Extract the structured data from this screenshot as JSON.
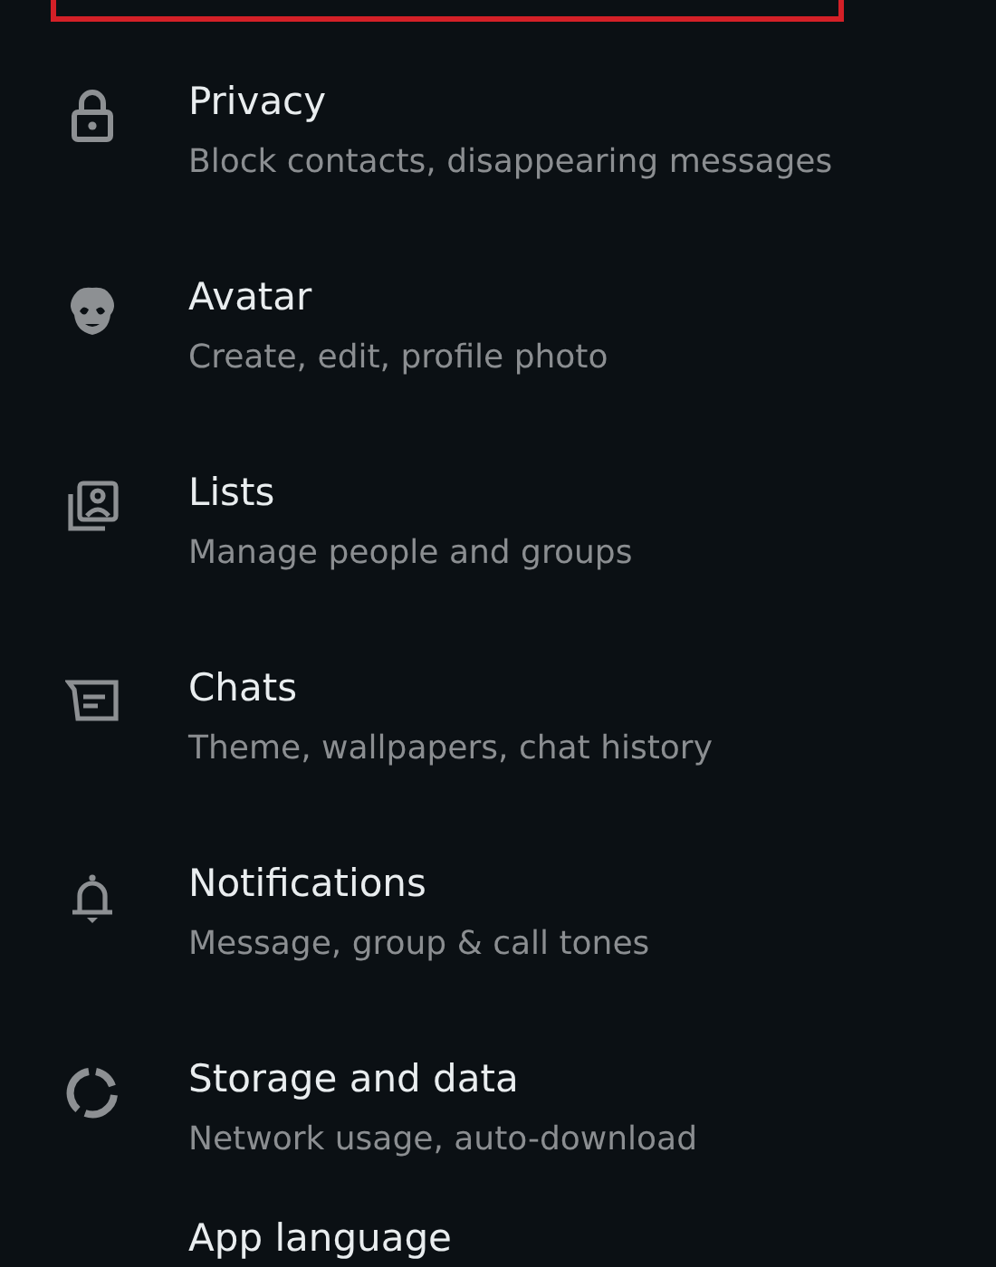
{
  "highlight_frame": {
    "shown": true
  },
  "settings": [
    {
      "title": "Privacy",
      "subtitle": "Block contacts, disappearing messages"
    },
    {
      "title": "Avatar",
      "subtitle": "Create, edit, profile photo"
    },
    {
      "title": "Lists",
      "subtitle": "Manage people and groups"
    },
    {
      "title": "Chats",
      "subtitle": "Theme, wallpapers, chat history"
    },
    {
      "title": "Notifications",
      "subtitle": "Message, group & call tones"
    },
    {
      "title": "Storage and data",
      "subtitle": "Network usage, auto-download"
    },
    {
      "title": "App language"
    }
  ]
}
